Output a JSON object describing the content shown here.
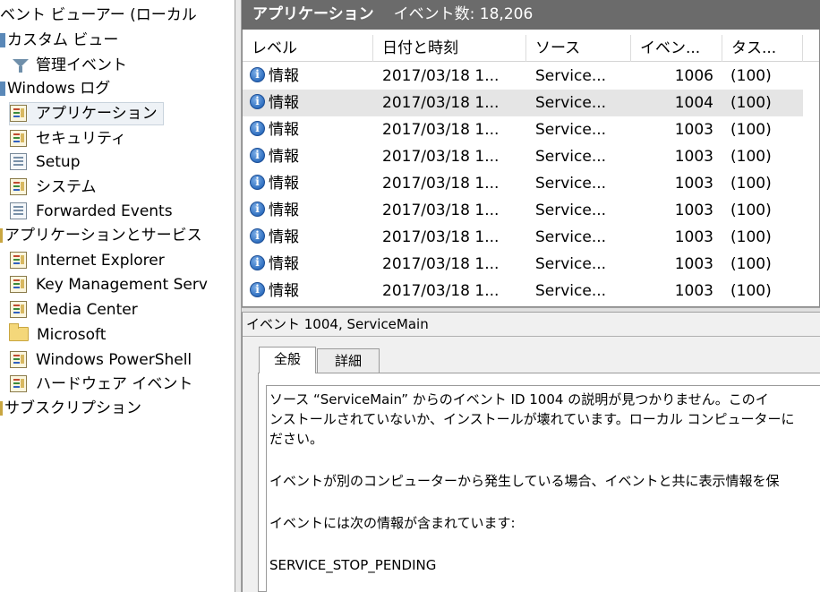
{
  "tree": {
    "root": "ベント ビューアー (ローカル",
    "custom_views": "カスタム ビュー",
    "admin_events": "管理イベント",
    "windows_logs": "Windows ログ",
    "application": "アプリケーション",
    "security": "セキュリティ",
    "setup": "Setup",
    "system": "システム",
    "forwarded": "Forwarded Events",
    "apps_services": "アプリケーションとサービス",
    "internet_explorer": "Internet Explorer",
    "key_management": "Key Management Serv",
    "media_center": "Media Center",
    "microsoft": "Microsoft",
    "powershell": "Windows PowerShell",
    "hardware_events": "ハードウェア イベント",
    "subscriptions": "サブスクリプション"
  },
  "header": {
    "title": "アプリケーション",
    "count": "イベント数: 18,206"
  },
  "columns": {
    "level": "レベル",
    "datetime": "日付と時刻",
    "source": "ソース",
    "event_id": "イベン...",
    "task": "タス..."
  },
  "rows": [
    {
      "level": "情報",
      "datetime": "2017/03/18 1...",
      "source": "Service...",
      "event_id": "1006",
      "task": "(100)"
    },
    {
      "level": "情報",
      "datetime": "2017/03/18 1...",
      "source": "Service...",
      "event_id": "1004",
      "task": "(100)"
    },
    {
      "level": "情報",
      "datetime": "2017/03/18 1...",
      "source": "Service...",
      "event_id": "1003",
      "task": "(100)"
    },
    {
      "level": "情報",
      "datetime": "2017/03/18 1...",
      "source": "Service...",
      "event_id": "1003",
      "task": "(100)"
    },
    {
      "level": "情報",
      "datetime": "2017/03/18 1...",
      "source": "Service...",
      "event_id": "1003",
      "task": "(100)"
    },
    {
      "level": "情報",
      "datetime": "2017/03/18 1...",
      "source": "Service...",
      "event_id": "1003",
      "task": "(100)"
    },
    {
      "level": "情報",
      "datetime": "2017/03/18 1...",
      "source": "Service...",
      "event_id": "1003",
      "task": "(100)"
    },
    {
      "level": "情報",
      "datetime": "2017/03/18 1...",
      "source": "Service...",
      "event_id": "1003",
      "task": "(100)"
    },
    {
      "level": "情報",
      "datetime": "2017/03/18 1...",
      "source": "Service...",
      "event_id": "1003",
      "task": "(100)"
    }
  ],
  "info_glyph": "i",
  "detail": {
    "title": "イベント 1004, ServiceMain",
    "tab_general": "全般",
    "tab_details": "詳細",
    "line1": "ソース “ServiceMain” からのイベント ID 1004 の説明が見つかりません。このイ",
    "line2": "ンストールされていないか、インストールが壊れています。ローカル コンピューターに",
    "line3": "ださい。",
    "line4": "イベントが別のコンピューターから発生している場合、イベントと共に表示情報を保",
    "line5": "イベントには次の情報が含まれています:",
    "line6": "SERVICE_STOP_PENDING"
  }
}
